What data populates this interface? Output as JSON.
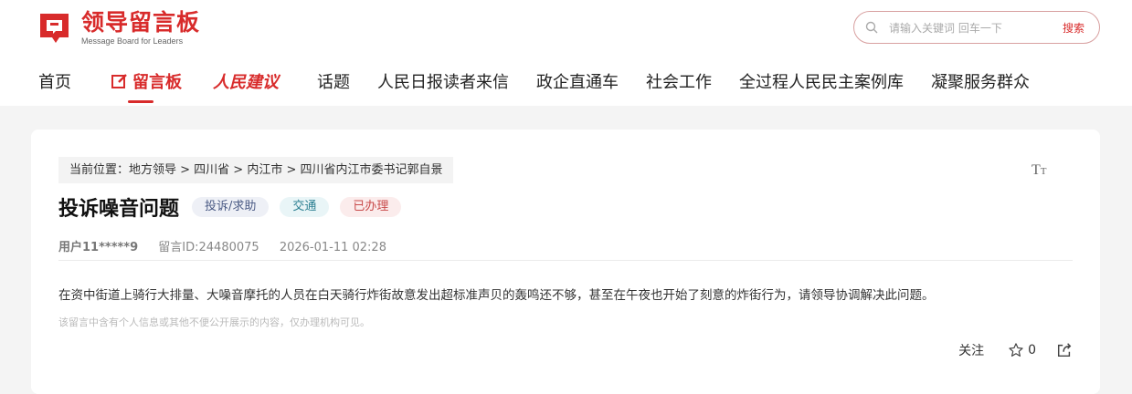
{
  "brand": {
    "name_cn": "领导留言板",
    "name_en": "Message Board for Leaders",
    "logo_icon": "message-board-logo"
  },
  "search": {
    "placeholder": "请输入关键词 回车一下",
    "button_label": "搜索"
  },
  "nav": {
    "items": [
      {
        "label": "首页"
      },
      {
        "label": "留言板"
      },
      {
        "label": "人民建议"
      },
      {
        "label": "话题"
      },
      {
        "label": "人民日报读者来信"
      },
      {
        "label": "政企直通车"
      },
      {
        "label": "社会工作"
      },
      {
        "label": "全过程人民民主案例库"
      },
      {
        "label": "凝聚服务群众"
      }
    ],
    "active": "留言板"
  },
  "breadcrumb": "当前位置：地方领导 > 四川省 > 内江市 > 四川省内江市委书记郭自景",
  "post": {
    "title": "投诉噪音问题",
    "tags": {
      "type": "投诉/求助",
      "domain": "交通",
      "status": "已办理"
    },
    "user": "用户11*****9",
    "message_id": "留言ID:24480075",
    "datetime": "2026-01-11 02:28",
    "content": "在资中街道上骑行大排量、大噪音摩托的人员在白天骑行炸街故意发出超标准声贝的轰鸣还不够，甚至在午夜也开始了刻意的炸街行为，请领导协调解决此问题。",
    "privacy_note": "该留言中含有个人信息或其他不便公开展示的内容，仅办理机构可见。"
  },
  "actions": {
    "follow_label": "关注",
    "like_count": "0"
  },
  "colors": {
    "brand_red": "#d82b2b",
    "status_red": "#c84a4a"
  }
}
